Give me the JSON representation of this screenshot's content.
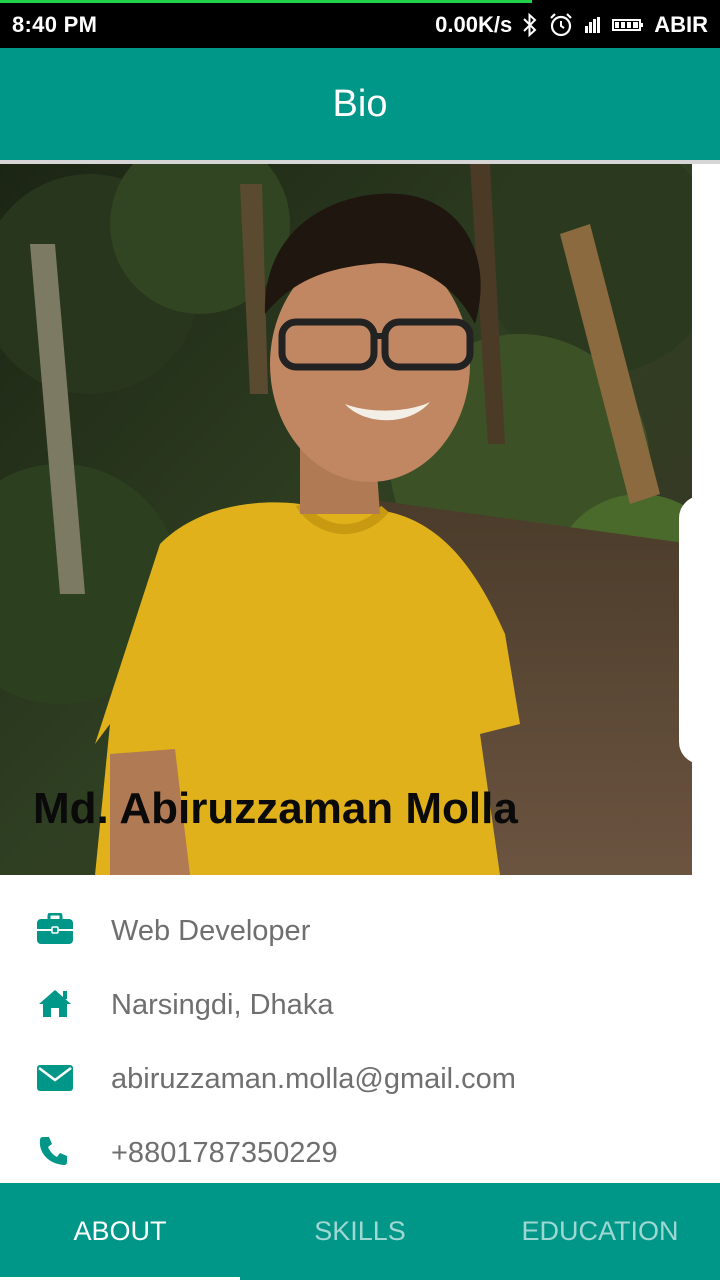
{
  "status_bar": {
    "time": "8:40 PM",
    "net_speed": "0.00K/s",
    "carrier": "ABIR",
    "icons": [
      "bluetooth-icon",
      "alarm-icon",
      "signal-icon",
      "battery-icon"
    ]
  },
  "app_bar": {
    "title": "Bio"
  },
  "profile": {
    "name": "Md. Abiruzzaman Molla",
    "photo_description": "photo-of-person"
  },
  "info": [
    {
      "icon": "briefcase-icon",
      "text": "Web Developer"
    },
    {
      "icon": "home-icon",
      "text": "Narsingdi, Dhaka"
    },
    {
      "icon": "email-icon",
      "text": "abiruzzaman.molla@gmail.com"
    },
    {
      "icon": "phone-icon",
      "text": "+8801787350229"
    }
  ],
  "tabs": [
    {
      "label": "ABOUT",
      "selected": true
    },
    {
      "label": "SKILLS",
      "selected": false
    },
    {
      "label": "EDUCATION",
      "selected": false
    }
  ],
  "colors": {
    "primary": "#009688",
    "tab_inactive": "#9fd8d2",
    "info_text": "#6f6f6f",
    "status_progress": "#1fd24a"
  }
}
